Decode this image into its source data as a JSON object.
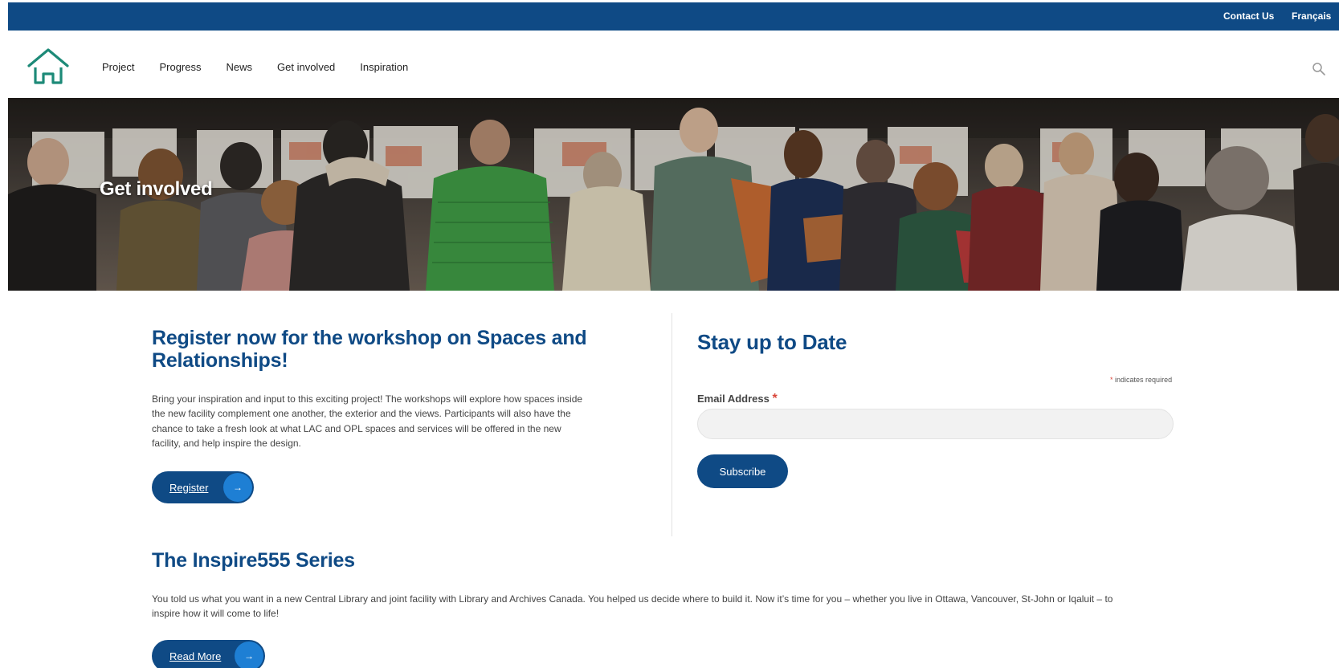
{
  "utility": {
    "contact_label": "Contact Us",
    "language_label": "Français"
  },
  "nav": {
    "items": [
      {
        "label": "Project"
      },
      {
        "label": "Progress"
      },
      {
        "label": "News"
      },
      {
        "label": "Get involved"
      },
      {
        "label": "Inspiration"
      }
    ],
    "logo_icon": "house-icon",
    "search_icon": "search-icon"
  },
  "hero": {
    "title": "Get involved"
  },
  "workshop": {
    "title": "Register now for the workshop on Spaces and Relationships!",
    "body": "Bring your inspiration and input to this exciting project! The workshops will explore how spaces inside the new facility complement one another, the exterior and the views. Participants will also have the chance to take a fresh look at what LAC and OPL spaces and services will be offered in the new facility, and help inspire the design.",
    "button_label": "Register",
    "button_arrow": "→"
  },
  "newsletter": {
    "title_prefix": "Stay up to",
    "title_bold": "Date",
    "required_star": "*",
    "required_note": "indicates required",
    "email_label": "Email Address",
    "email_star": "*",
    "email_value": "",
    "subscribe_label": "Subscribe"
  },
  "series": {
    "title": "The Inspire555 Series",
    "body": "You told us what you want in a new Central Library and joint facility with Library and Archives Canada. You helped us decide where to build it. Now it’s time for you – whether you live in Ottawa, Vancouver, St-John or Iqaluit – to inspire how it will come to life!",
    "button_label": "Read More",
    "button_arrow": "→"
  },
  "colors": {
    "brand_blue": "#0f4a85",
    "accent_blue": "#1e7fd4",
    "logo_teal": "#1d8a78",
    "required_red": "#d9463a"
  }
}
